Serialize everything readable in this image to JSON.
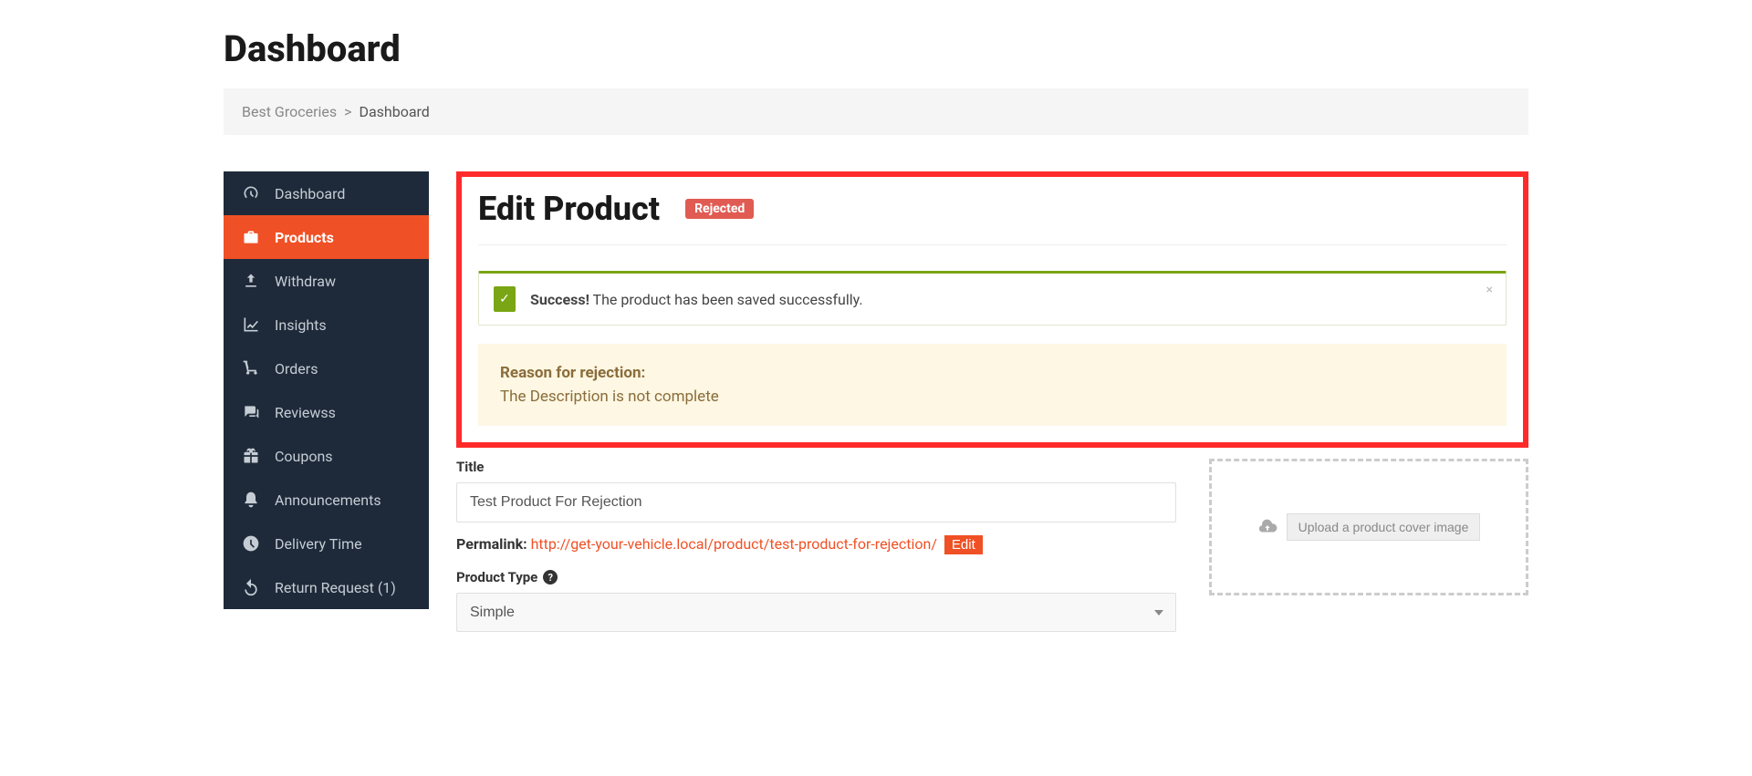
{
  "page": {
    "title": "Dashboard"
  },
  "breadcrumb": {
    "store": "Best Groceries",
    "separator": ">",
    "current": "Dashboard"
  },
  "sidebar": {
    "items": [
      {
        "label": "Dashboard"
      },
      {
        "label": "Products"
      },
      {
        "label": "Withdraw"
      },
      {
        "label": "Insights"
      },
      {
        "label": "Orders"
      },
      {
        "label": "Reviewss"
      },
      {
        "label": "Coupons"
      },
      {
        "label": "Announcements"
      },
      {
        "label": "Delivery Time"
      },
      {
        "label": "Return Request (1)"
      }
    ]
  },
  "edit": {
    "heading": "Edit Product",
    "status_badge": "Rejected"
  },
  "alerts": {
    "success_strong": "Success!",
    "success_message": " The product has been saved successfully.",
    "reason_title": "Reason for rejection:",
    "reason_body": "The Description is not complete"
  },
  "form": {
    "title_label": "Title",
    "title_value": "Test Product For Rejection",
    "permalink_label": "Permalink:",
    "permalink_url": "http://get-your-vehicle.local/product/test-product-for-rejection/",
    "permalink_edit": "Edit",
    "product_type_label": "Product Type",
    "product_type_value": "Simple",
    "upload_label": "Upload a product cover image"
  }
}
